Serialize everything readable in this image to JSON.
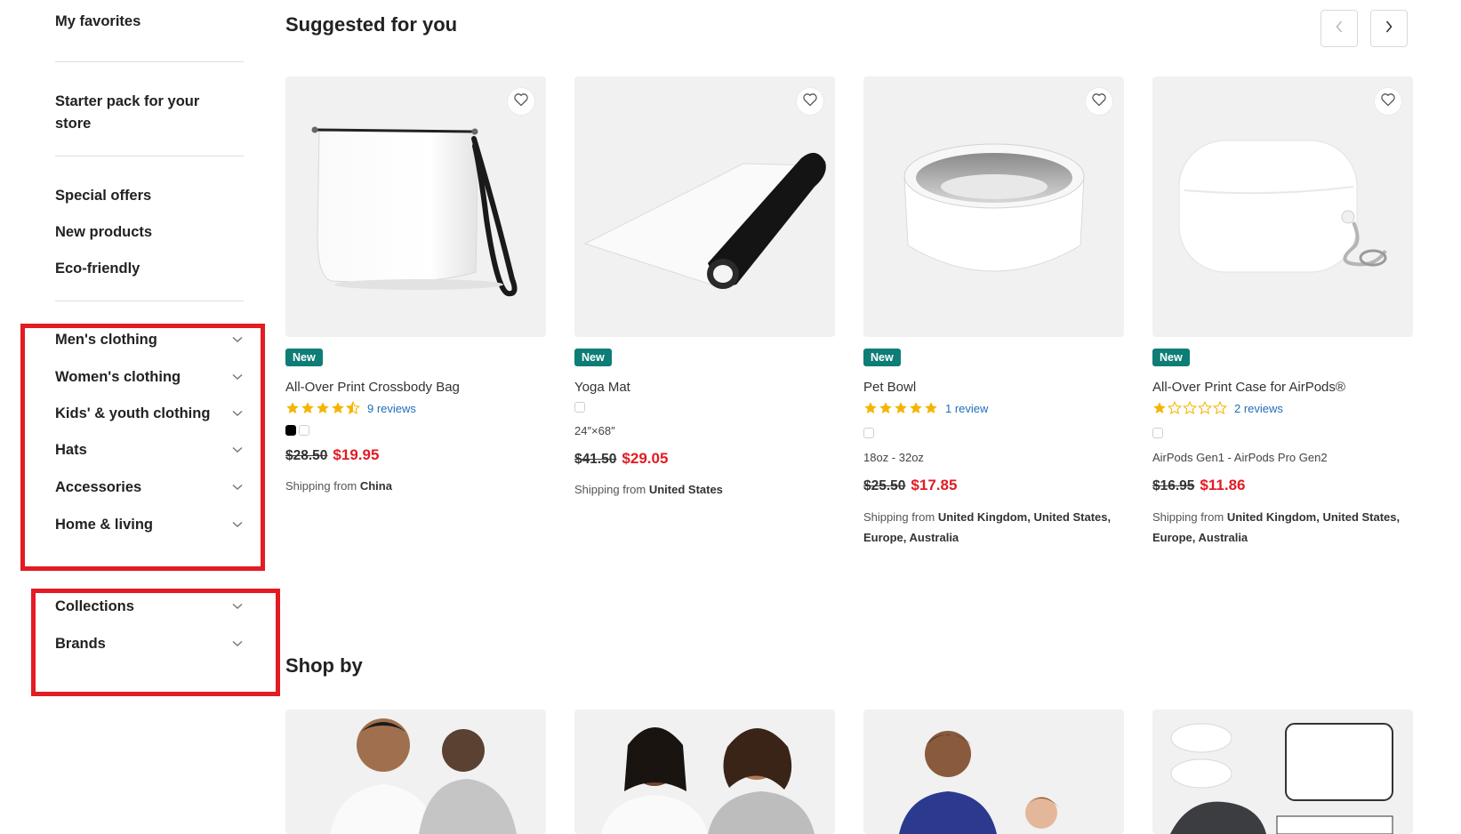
{
  "sidebar": {
    "my_favorites": "My favorites",
    "starter_pack": "Starter pack for your store",
    "special_offers": "Special offers",
    "new_products": "New products",
    "eco_friendly": "Eco-friendly",
    "categories": [
      {
        "label": "Men's clothing"
      },
      {
        "label": "Women's clothing"
      },
      {
        "label": "Kids' & youth clothing"
      },
      {
        "label": "Hats"
      },
      {
        "label": "Accessories"
      },
      {
        "label": "Home & living"
      }
    ],
    "extra": [
      {
        "label": "Collections"
      },
      {
        "label": "Brands"
      }
    ],
    "highlight_color": "#e31b23"
  },
  "suggested": {
    "title": "Suggested for you",
    "prev_icon": "chevron-left-icon",
    "next_icon": "chevron-right-icon",
    "badge_color": "#0d7d75",
    "sale_color": "#e31b23",
    "products": [
      {
        "badge": "New",
        "name": "All-Over Print Crossbody Bag",
        "rating": 4.5,
        "reviews": "9 reviews",
        "option": "",
        "old_price": "$28.50",
        "price": "$19.95",
        "shipping_label": "Shipping from",
        "shipping_from": "China"
      },
      {
        "badge": "New",
        "name": "Yoga Mat",
        "option": "24″×68″",
        "old_price": "$41.50",
        "price": "$29.05",
        "shipping_label": "Shipping from",
        "shipping_from": "United States"
      },
      {
        "badge": "New",
        "name": "Pet Bowl",
        "rating": 5,
        "reviews": "1 review",
        "option": "18oz - 32oz",
        "old_price": "$25.50",
        "price": "$17.85",
        "shipping_label": "Shipping from",
        "shipping_from": "United Kingdom, United States, Europe, Australia"
      },
      {
        "badge": "New",
        "name": "All-Over Print Case for AirPods®",
        "rating": 1,
        "reviews": "2 reviews",
        "option": "AirPods Gen1 - AirPods Pro Gen2",
        "old_price": "$16.95",
        "price": "$11.86",
        "shipping_label": "Shipping from",
        "shipping_from": "United Kingdom, United States, Europe, Australia"
      }
    ]
  },
  "shop_by": {
    "title": "Shop by"
  }
}
